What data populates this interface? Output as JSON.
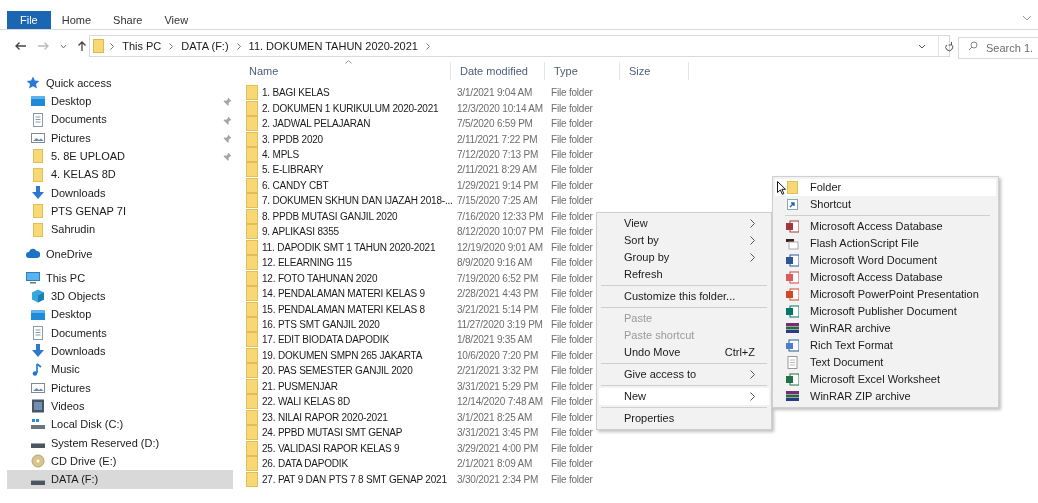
{
  "ribbon": {
    "tabs": [
      {
        "label": "File",
        "selected": true
      },
      {
        "label": "Home",
        "selected": false
      },
      {
        "label": "Share",
        "selected": false
      },
      {
        "label": "View",
        "selected": false
      }
    ]
  },
  "address_bar": {
    "segments": [
      "This PC",
      "DATA (F:)",
      "11. DOKUMEN TAHUN 2020-2021"
    ]
  },
  "search": {
    "placeholder": "Search 1."
  },
  "navigation_pane": {
    "groups": [
      {
        "label": "Quick access",
        "kind": "star",
        "selected": false,
        "children": [
          {
            "label": "Desktop",
            "kind": "desktop",
            "pinned": true,
            "selected": false
          },
          {
            "label": "Documents",
            "kind": "documents",
            "pinned": true,
            "selected": false
          },
          {
            "label": "Pictures",
            "kind": "pictures",
            "pinned": true,
            "selected": false
          },
          {
            "label": "5. 8E UPLOAD",
            "kind": "folder",
            "pinned": true,
            "selected": false
          },
          {
            "label": "4. KELAS 8D",
            "kind": "folder",
            "pinned": false,
            "selected": false
          },
          {
            "label": "Downloads",
            "kind": "downloads",
            "pinned": false,
            "selected": false
          },
          {
            "label": "PTS GENAP 7I",
            "kind": "folder",
            "pinned": false,
            "selected": false
          },
          {
            "label": "Sahrudin",
            "kind": "folder",
            "pinned": false,
            "selected": false
          }
        ]
      },
      {
        "label": "OneDrive",
        "kind": "cloud",
        "selected": false
      },
      {
        "label": "This PC",
        "kind": "pc",
        "selected": false,
        "children": [
          {
            "label": "3D Objects",
            "kind": "cube",
            "selected": false
          },
          {
            "label": "Desktop",
            "kind": "desktop",
            "selected": false
          },
          {
            "label": "Documents",
            "kind": "documents",
            "selected": false
          },
          {
            "label": "Downloads",
            "kind": "downloads",
            "selected": false
          },
          {
            "label": "Music",
            "kind": "music",
            "selected": false
          },
          {
            "label": "Pictures",
            "kind": "pictures",
            "selected": false
          },
          {
            "label": "Videos",
            "kind": "videos",
            "selected": false
          },
          {
            "label": "Local Disk (C:)",
            "kind": "system-disk",
            "selected": false
          },
          {
            "label": "System Reserved (D:)",
            "kind": "drive",
            "selected": false
          },
          {
            "label": "CD Drive (E:)",
            "kind": "cd",
            "selected": false
          },
          {
            "label": "DATA (F:)",
            "kind": "drive",
            "selected": true
          }
        ]
      }
    ]
  },
  "file_list": {
    "columns": [
      {
        "label": "Name",
        "sorted": true
      },
      {
        "label": "Date modified",
        "sorted": false
      },
      {
        "label": "Type",
        "sorted": false
      },
      {
        "label": "Size",
        "sorted": false
      }
    ],
    "rows": [
      {
        "name": "1. BAGI KELAS",
        "date_modified": "3/1/2021 9:04 AM",
        "type": "File folder"
      },
      {
        "name": "2. DOKUMEN 1 KURIKULUM 2020-2021",
        "date_modified": "12/3/2020 10:14 AM",
        "type": "File folder"
      },
      {
        "name": "2. JADWAL PELAJARAN",
        "date_modified": "7/5/2020 6:59 PM",
        "type": "File folder"
      },
      {
        "name": "3. PPDB 2020",
        "date_modified": "2/11/2021 7:22 PM",
        "type": "File folder"
      },
      {
        "name": "4. MPLS",
        "date_modified": "7/12/2020 7:13 PM",
        "type": "File folder"
      },
      {
        "name": "5. E-LIBRARY",
        "date_modified": "2/11/2021 8:29 AM",
        "type": "File folder"
      },
      {
        "name": "6. CANDY CBT",
        "date_modified": "1/29/2021 9:14 PM",
        "type": "File folder"
      },
      {
        "name": "7. DOKUMEN SKHUN DAN IJAZAH 2018-...",
        "date_modified": "7/15/2020 7:25 AM",
        "type": "File folder"
      },
      {
        "name": "8. PPDB MUTASI GANJIL 2020",
        "date_modified": "7/16/2020 12:33 PM",
        "type": "File folder"
      },
      {
        "name": "9. APLIKASI 8355",
        "date_modified": "8/12/2020 10:07 PM",
        "type": "File folder"
      },
      {
        "name": "11. DAPODIK SMT 1 TAHUN 2020-2021",
        "date_modified": "12/19/2020 9:01 AM",
        "type": "File folder"
      },
      {
        "name": "12. ELEARNING 115",
        "date_modified": "8/9/2020 9:16 AM",
        "type": "File folder"
      },
      {
        "name": "12. FOTO TAHUNAN 2020",
        "date_modified": "7/19/2020 6:52 PM",
        "type": "File folder"
      },
      {
        "name": "14. PENDALAMAN MATERI KELAS 9",
        "date_modified": "2/28/2021 4:43 PM",
        "type": "File folder"
      },
      {
        "name": "15. PENDALAMAN MATERI KELAS 8",
        "date_modified": "3/21/2021 5:14 PM",
        "type": "File folder"
      },
      {
        "name": "16. PTS SMT GANJIL 2020",
        "date_modified": "11/27/2020 3:19 PM",
        "type": "File folder"
      },
      {
        "name": "17. EDIT BIODATA DAPODIK",
        "date_modified": "1/8/2021 9:35 AM",
        "type": "File folder"
      },
      {
        "name": "19. DOKUMEN SMPN 265 JAKARTA",
        "date_modified": "10/6/2020 7:20 PM",
        "type": "File folder"
      },
      {
        "name": "20. PAS SEMESTER GANJIL 2020",
        "date_modified": "2/21/2021 3:32 PM",
        "type": "File folder"
      },
      {
        "name": "21. PUSMENJAR",
        "date_modified": "3/31/2021 5:29 PM",
        "type": "File folder"
      },
      {
        "name": "22. WALI KELAS 8D",
        "date_modified": "12/14/2020 7:48 AM",
        "type": "File folder"
      },
      {
        "name": "23. NILAI RAPOR 2020-2021",
        "date_modified": "3/1/2021 8:25 AM",
        "type": "File folder"
      },
      {
        "name": "24. PPBD MUTASI SMT GENAP",
        "date_modified": "3/31/2021 3:45 PM",
        "type": "File folder"
      },
      {
        "name": "25. VALIDASI RAPOR KELAS 9",
        "date_modified": "3/29/2021 4:00 PM",
        "type": "File folder"
      },
      {
        "name": "26. DATA DAPODIK",
        "date_modified": "2/1/2021 8:09 AM",
        "type": "File folder"
      },
      {
        "name": "27. PAT 9 DAN PTS 7 8 SMT GENAP 2021",
        "date_modified": "3/30/2021 2:34 PM",
        "type": "File folder"
      }
    ]
  },
  "context_menu": {
    "items": [
      {
        "kind": "item",
        "label": "View",
        "submenu": true,
        "disabled": false,
        "selected": false
      },
      {
        "kind": "item",
        "label": "Sort by",
        "submenu": true,
        "disabled": false,
        "selected": false
      },
      {
        "kind": "item",
        "label": "Group by",
        "submenu": true,
        "disabled": false,
        "selected": false
      },
      {
        "kind": "item",
        "label": "Refresh",
        "submenu": false,
        "disabled": false,
        "selected": false
      },
      {
        "kind": "separator"
      },
      {
        "kind": "item",
        "label": "Customize this folder...",
        "submenu": false,
        "disabled": false,
        "selected": false
      },
      {
        "kind": "separator"
      },
      {
        "kind": "item",
        "label": "Paste",
        "submenu": false,
        "disabled": true,
        "selected": false
      },
      {
        "kind": "item",
        "label": "Paste shortcut",
        "submenu": false,
        "disabled": true,
        "selected": false
      },
      {
        "kind": "item",
        "label": "Undo Move",
        "shortcut": "Ctrl+Z",
        "submenu": false,
        "disabled": false,
        "selected": false
      },
      {
        "kind": "separator"
      },
      {
        "kind": "item",
        "label": "Give access to",
        "submenu": true,
        "disabled": false,
        "selected": false
      },
      {
        "kind": "separator"
      },
      {
        "kind": "item",
        "label": "New",
        "submenu": true,
        "disabled": false,
        "selected": true
      },
      {
        "kind": "separator"
      },
      {
        "kind": "item",
        "label": "Properties",
        "submenu": false,
        "disabled": false,
        "selected": false
      }
    ]
  },
  "new_submenu": {
    "items": [
      {
        "kind": "folder",
        "label": "Folder",
        "selected": true
      },
      {
        "kind": "shortcut",
        "label": "Shortcut",
        "selected": false
      },
      {
        "kind": "separator"
      },
      {
        "kind": "access",
        "label": "Microsoft Access Database",
        "selected": false
      },
      {
        "kind": "flash",
        "label": "Flash ActionScript File",
        "selected": false
      },
      {
        "kind": "word",
        "label": "Microsoft Word Document",
        "selected": false
      },
      {
        "kind": "access-alt",
        "label": "Microsoft Access Database",
        "selected": false
      },
      {
        "kind": "powerpoint",
        "label": "Microsoft PowerPoint Presentation",
        "selected": false
      },
      {
        "kind": "publisher",
        "label": "Microsoft Publisher Document",
        "selected": false
      },
      {
        "kind": "winrar",
        "label": "WinRAR archive",
        "selected": false
      },
      {
        "kind": "rtf",
        "label": "Rich Text Format",
        "selected": false
      },
      {
        "kind": "text",
        "label": "Text Document",
        "selected": false
      },
      {
        "kind": "excel",
        "label": "Microsoft Excel Worksheet",
        "selected": false
      },
      {
        "kind": "winrar",
        "label": "WinRAR ZIP archive",
        "selected": false
      }
    ]
  }
}
